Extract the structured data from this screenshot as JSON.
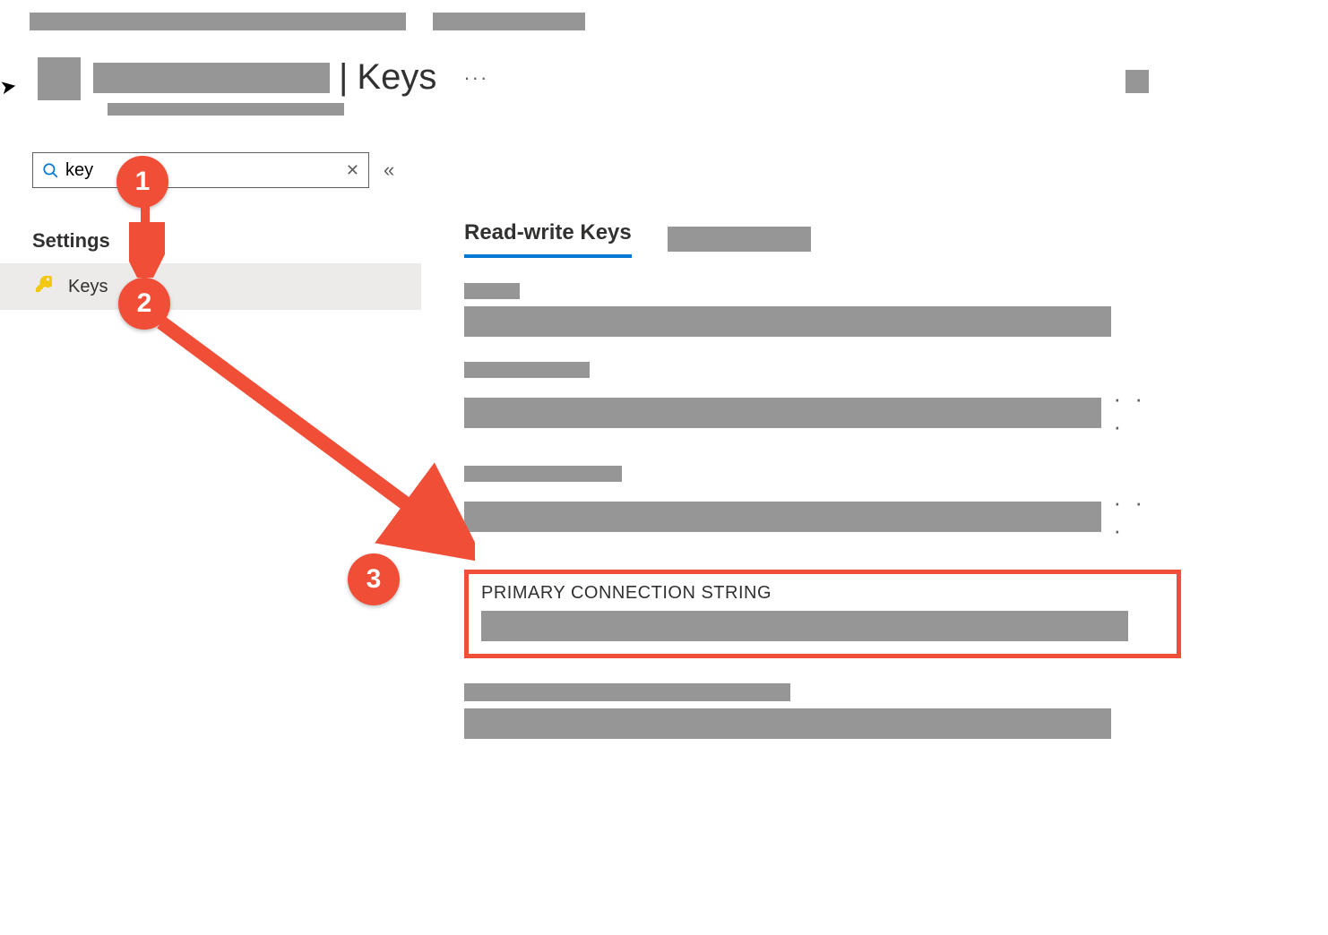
{
  "header": {
    "title_suffix": "Keys",
    "more_dots": "···"
  },
  "sidebar": {
    "search_value": "key",
    "section_header": "Settings",
    "item_keys_label": "Keys",
    "collapse_glyph": "«"
  },
  "main": {
    "tab_active": "Read-write Keys",
    "pcs_label": "PRIMARY CONNECTION STRING",
    "more_dots": "· · ·"
  },
  "annotations": {
    "step1": "1",
    "step2": "2",
    "step3": "3"
  }
}
